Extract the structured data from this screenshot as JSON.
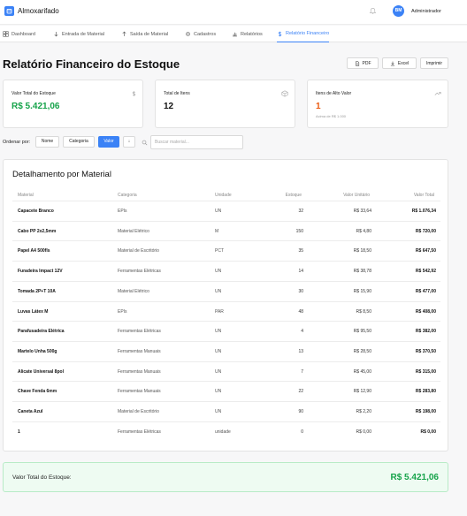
{
  "app": {
    "title": "Almoxarifado",
    "user_initials": "BM",
    "user_name": "Administrador"
  },
  "nav": [
    {
      "label": "Dashboard",
      "icon": "dashboard-icon"
    },
    {
      "label": "Entrada de Material",
      "icon": "arrow-down-icon"
    },
    {
      "label": "Saída de Material",
      "icon": "arrow-up-icon"
    },
    {
      "label": "Cadastros",
      "icon": "gear-icon"
    },
    {
      "label": "Relatórios",
      "icon": "bar-chart-icon"
    },
    {
      "label": "Relatório Financeiro",
      "icon": "dollar-icon",
      "active": true
    }
  ],
  "page": {
    "title": "Relatório Financeiro do Estoque",
    "buttons": {
      "pdf": "PDF",
      "excel": "Excel",
      "print": "Imprimir"
    }
  },
  "cards": [
    {
      "label": "Valor Total do Estoque",
      "value": "R$ 5.421,06",
      "icon": "dollar-icon",
      "color": "#16a34a"
    },
    {
      "label": "Total de Itens",
      "value": "12",
      "icon": "box-icon",
      "color": "#111111"
    },
    {
      "label": "Itens de Alto Valor",
      "value": "1",
      "sub": "Acima de R$ 1.000",
      "icon": "trend-up-icon",
      "color": "#ea580c"
    }
  ],
  "sort": {
    "label": "Ordenar por:",
    "options": [
      "Nome",
      "Categoria",
      "Valor"
    ],
    "active": "Valor",
    "direction": "↓",
    "search_placeholder": "Buscar material..."
  },
  "table": {
    "title": "Detalhamento por Material",
    "headers": [
      "Material",
      "Categoria",
      "Unidade",
      "Estoque",
      "Valor Unitário",
      "Valor Total"
    ],
    "rows": [
      [
        "Capacete Branco",
        "EPIs",
        "UN",
        "32",
        "R$ 33,64",
        "R$ 1.076,34"
      ],
      [
        "Cabo PP 2x2,5mm",
        "Material Elétrico",
        "M",
        "150",
        "R$ 4,80",
        "R$ 720,00"
      ],
      [
        "Papel A4 500fls",
        "Material de Escritório",
        "PCT",
        "35",
        "R$ 18,50",
        "R$ 647,50"
      ],
      [
        "Furadeira Impact 12V",
        "Ferramentas Elétricas",
        "UN",
        "14",
        "R$ 38,78",
        "R$ 542,92"
      ],
      [
        "Tomada 2P+T 10A",
        "Material Elétrico",
        "UN",
        "30",
        "R$ 15,90",
        "R$ 477,00"
      ],
      [
        "Luvas Látex M",
        "EPIs",
        "PAR",
        "48",
        "R$ 8,50",
        "R$ 408,00"
      ],
      [
        "Parafusadeira Elétrica",
        "Ferramentas Elétricas",
        "UN",
        "4",
        "R$ 95,50",
        "R$ 382,00"
      ],
      [
        "Martelo Unha 500g",
        "Ferramentas Manuais",
        "UN",
        "13",
        "R$ 28,50",
        "R$ 370,50"
      ],
      [
        "Alicate Universal 8pol",
        "Ferramentas Manuais",
        "UN",
        "7",
        "R$ 45,00",
        "R$ 315,00"
      ],
      [
        "Chave Fenda 6mm",
        "Ferramentas Manuais",
        "UN",
        "22",
        "R$ 12,90",
        "R$ 283,80"
      ],
      [
        "Caneta Azul",
        "Material de Escritório",
        "UN",
        "90",
        "R$ 2,20",
        "R$ 198,00"
      ],
      [
        "1",
        "Ferramentas Elétricas",
        "unidade",
        "0",
        "R$ 0,00",
        "R$ 0,00"
      ]
    ]
  },
  "footer_total": {
    "label": "Valor Total do Estoque:",
    "value": "R$ 5.421,06"
  },
  "colors": {
    "accent": "#3b82f6",
    "money": "#16a34a",
    "warning": "#ea580c"
  }
}
